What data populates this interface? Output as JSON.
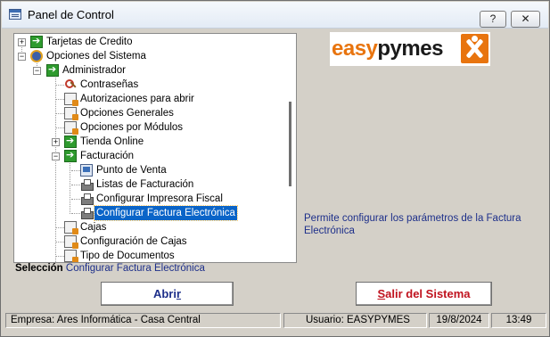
{
  "window": {
    "title": "Panel de Control",
    "help_glyph": "?",
    "close_glyph": "✕"
  },
  "tree": {
    "items": [
      {
        "label": "Tarjetas de Credito",
        "icon": "arrow-right-icon",
        "level": 0,
        "expander": "+"
      },
      {
        "label": "Opciones del Sistema",
        "icon": "system-settings-icon",
        "level": 0,
        "expander": "−"
      },
      {
        "label": "Administrador",
        "icon": "arrow-right-icon",
        "level": 1,
        "expander": "−"
      },
      {
        "label": "Contraseñas",
        "icon": "keys-icon",
        "level": 2
      },
      {
        "label": "Autorizaciones para abrir",
        "icon": "document-icon",
        "level": 2
      },
      {
        "label": "Opciones Generales",
        "icon": "document-icon",
        "level": 2
      },
      {
        "label": "Opciones por Módulos",
        "icon": "document-icon",
        "level": 2
      },
      {
        "label": "Tienda Online",
        "icon": "arrow-right-icon",
        "level": 2,
        "expander": "+"
      },
      {
        "label": "Facturación",
        "icon": "arrow-right-icon",
        "level": 2,
        "expander": "−"
      },
      {
        "label": "Punto de Venta",
        "icon": "pos-terminal-icon",
        "level": 3
      },
      {
        "label": "Listas de Facturación",
        "icon": "printer-icon",
        "level": 3
      },
      {
        "label": "Configurar Impresora Fiscal",
        "icon": "printer-icon",
        "level": 3
      },
      {
        "label": "Configurar Factura Electrónica",
        "icon": "printer-icon",
        "level": 3,
        "selected": true
      },
      {
        "label": "Cajas",
        "icon": "document-icon",
        "level": 2
      },
      {
        "label": "Configuración de Cajas",
        "icon": "document-icon",
        "level": 2
      },
      {
        "label": "Tipo de Documentos",
        "icon": "document-icon",
        "level": 2
      }
    ]
  },
  "selection": {
    "label": "Selección",
    "value": "Configurar Factura Electrónica"
  },
  "logo": {
    "part1": "easy",
    "part2": "pymes"
  },
  "description": "Permite configurar los parámetros de la Factura Electrónica",
  "buttons": {
    "open_accel": "Abri",
    "open_rest": "r",
    "exit_accel": "S",
    "exit_rest": "alir del Sistema"
  },
  "status": {
    "company": "Empresa: Ares Informática - Casa Central",
    "user": "Usuario: EASYPYMES",
    "date": "19/8/2024",
    "time": "13:49"
  },
  "colors": {
    "selection_bg": "#0a64c8",
    "link_text": "#1d2f8a",
    "exit_text": "#c0121e",
    "brand_orange": "#e8740e"
  }
}
